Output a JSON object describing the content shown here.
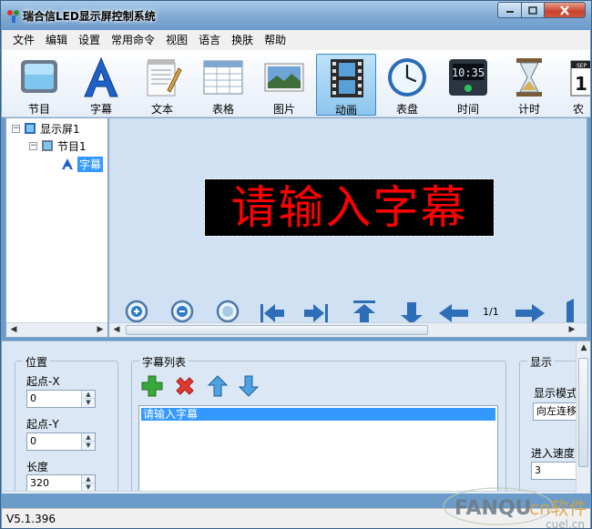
{
  "window": {
    "title": "瑞合信LED显示屏控制系统",
    "controls": {
      "minimize": "minimize",
      "maximize": "maximize",
      "close": "close"
    }
  },
  "menu": [
    "文件",
    "编辑",
    "设置",
    "常用命令",
    "视图",
    "语言",
    "换肤",
    "帮助"
  ],
  "toolbar": {
    "buttons": [
      {
        "label": "节目",
        "icon": "program-icon"
      },
      {
        "label": "字幕",
        "icon": "subtitle-icon"
      },
      {
        "label": "文本",
        "icon": "text-icon"
      },
      {
        "label": "表格",
        "icon": "table-icon"
      },
      {
        "label": "图片",
        "icon": "picture-icon"
      },
      {
        "label": "动画",
        "icon": "animation-icon",
        "active": true
      },
      {
        "label": "表盘",
        "icon": "clock-dial-icon"
      },
      {
        "label": "时间",
        "icon": "digital-time-icon"
      },
      {
        "label": "计时",
        "icon": "hourglass-icon"
      },
      {
        "label": "农",
        "icon": "calendar-icon"
      }
    ]
  },
  "tree": {
    "screen": "显示屏1",
    "program": "节目1",
    "subtitle": "字幕"
  },
  "preview": {
    "led_text": "请输入字幕",
    "led_color": "#ff0000",
    "page_indicator": "1/1",
    "tools": [
      "zoom-in-icon",
      "zoom-out-icon",
      "zoom-fit-icon",
      "first-icon",
      "last-icon",
      "move-top-icon",
      "move-down-icon",
      "prev-icon",
      "next-icon",
      "more-icon"
    ]
  },
  "properties": {
    "position": {
      "title": "位置",
      "start_x_label": "起点-X",
      "start_x": "0",
      "start_y_label": "起点-Y",
      "start_y": "0",
      "length_label": "长度",
      "length": "320"
    },
    "subtitle_list": {
      "title": "字幕列表",
      "items": [
        "请输入字幕"
      ]
    },
    "display": {
      "title": "显示",
      "mode_label": "显示模式",
      "mode_value": "向左连移",
      "speed_label": "进入速度",
      "speed_value": "3"
    }
  },
  "status": {
    "version": "V5.1.396"
  },
  "watermark": {
    "text": "FANQU",
    "chars": "cn软件",
    "domain": "cuel.cn"
  }
}
